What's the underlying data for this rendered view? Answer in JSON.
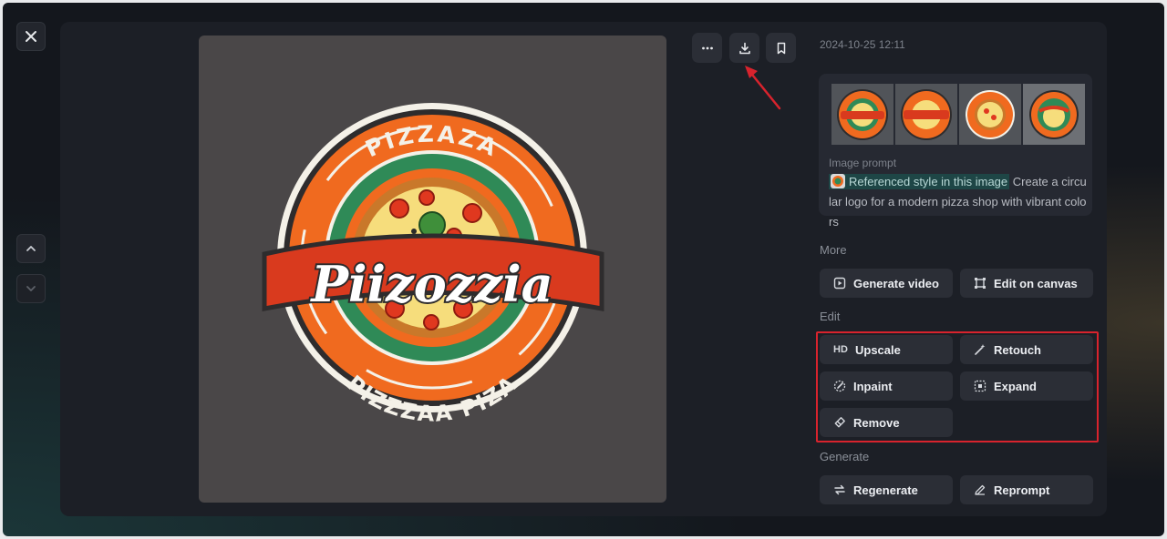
{
  "viewer": {
    "timestamp": "2024-10-25 12:11",
    "logo": {
      "arc_top_text": "PIZZAZA",
      "arc_bottom_text": "PIZZZAA PIZA",
      "banner_text": "Piizozzia"
    },
    "toolbar": {
      "more_icon": "more-horizontal-icon",
      "download_icon": "download-icon",
      "bookmark_icon": "bookmark-icon"
    },
    "prompt": {
      "label": "Image prompt",
      "reference_chip": "Referenced style in this image",
      "text": " Create a circular logo for a modern pizza shop with vibrant colors"
    },
    "sections": {
      "more": {
        "label": "More",
        "buttons": [
          {
            "label": "Generate video",
            "icon": "video-plus-icon"
          },
          {
            "label": "Edit on canvas",
            "icon": "canvas-frame-icon"
          }
        ]
      },
      "edit": {
        "label": "Edit",
        "buttons": [
          {
            "label": "Upscale",
            "icon_text": "HD"
          },
          {
            "label": "Retouch",
            "icon": "magic-wand-icon"
          },
          {
            "label": "Inpaint",
            "icon": "brush-circle-icon"
          },
          {
            "label": "Expand",
            "icon": "expand-frame-icon"
          },
          {
            "label": "Remove",
            "icon": "eraser-icon"
          }
        ]
      },
      "generate": {
        "label": "Generate",
        "buttons": [
          {
            "label": "Regenerate",
            "icon": "refresh-icon"
          },
          {
            "label": "Reprompt",
            "icon": "pencil-icon"
          }
        ]
      }
    },
    "colors": {
      "accent_orange": "#f06a1f",
      "logo_green": "#2f8a57",
      "annotation_red": "#d8232d"
    }
  }
}
